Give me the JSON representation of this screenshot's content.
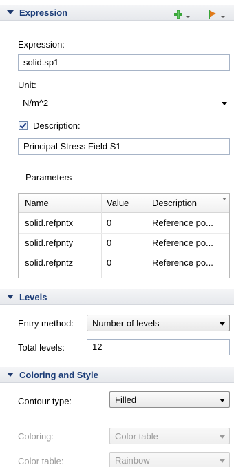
{
  "expression_section": {
    "title": "Expression",
    "expression_label": "Expression:",
    "expression_value": "solid.sp1",
    "unit_label": "Unit:",
    "unit_value": "N/m^2",
    "description_checked": true,
    "description_label": "Description:",
    "description_value": "Principal Stress Field S1",
    "parameters_label": "Parameters",
    "table": {
      "columns": [
        "Name",
        "Value",
        "Description"
      ],
      "rows": [
        [
          "solid.refpntx",
          "0",
          "Reference po..."
        ],
        [
          "solid.refpnty",
          "0",
          "Reference po..."
        ],
        [
          "solid.refpntz",
          "0",
          "Reference po..."
        ]
      ]
    }
  },
  "levels_section": {
    "title": "Levels",
    "entry_method_label": "Entry method:",
    "entry_method_value": "Number of levels",
    "total_levels_label": "Total levels:",
    "total_levels_value": "12"
  },
  "coloring_section": {
    "title": "Coloring and Style",
    "contour_type_label": "Contour type:",
    "contour_type_value": "Filled",
    "coloring_label": "Coloring:",
    "coloring_value": "Color table",
    "color_table_label": "Color table:",
    "color_table_value": "Rainbow"
  },
  "icons": {
    "add": "plus-icon",
    "replace": "flag-arrow-icon"
  },
  "colors": {
    "header_text": "#1c3d78",
    "add_icon": "#3aa53a",
    "replace_icon": "#e07a1a"
  }
}
